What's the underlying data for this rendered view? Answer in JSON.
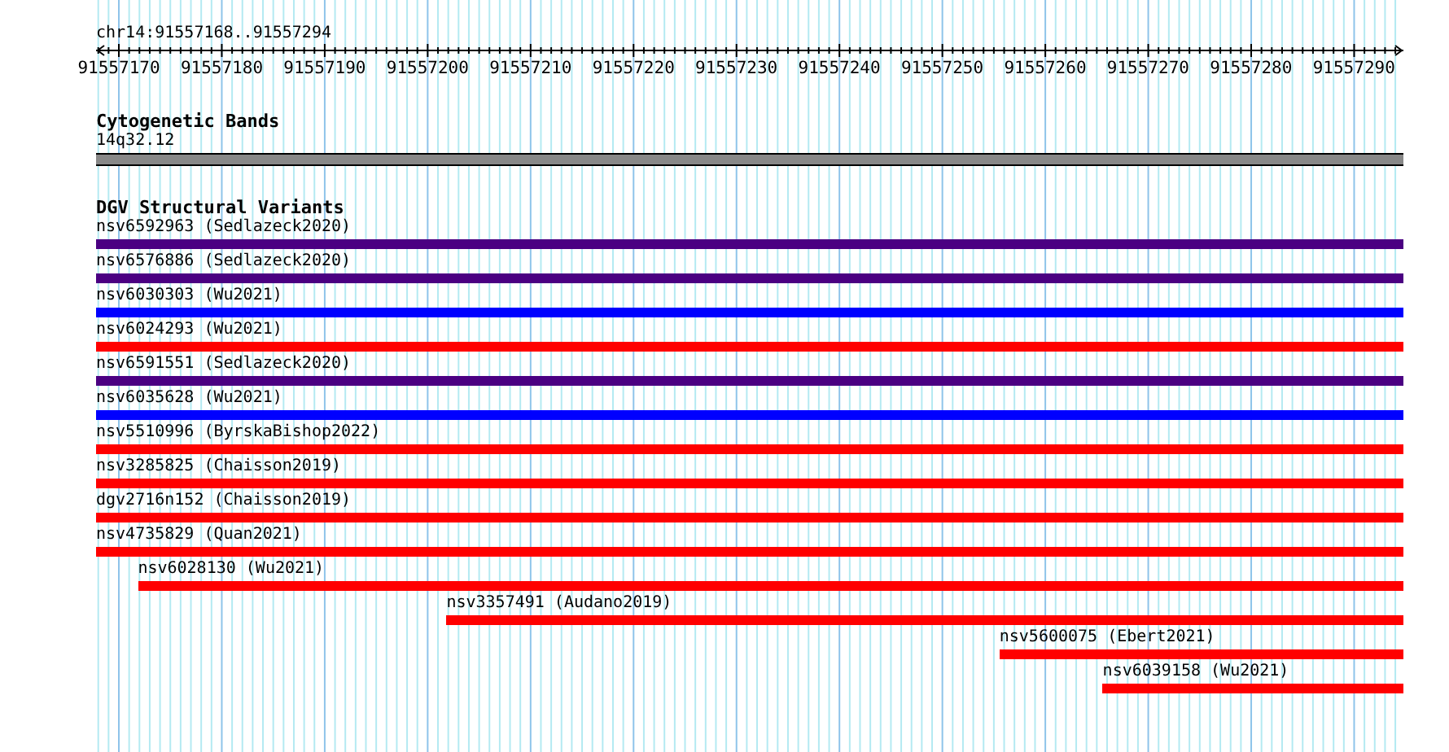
{
  "ruler": {
    "region": "chr14:91557168..91557294",
    "ticks": [
      "91557170",
      "91557180",
      "91557190",
      "91557200",
      "91557210",
      "91557220",
      "91557230",
      "91557240",
      "91557250",
      "91557260",
      "91557270",
      "91557280",
      "91557290"
    ]
  },
  "tracks": [
    {
      "title": "Cytogenetic Bands",
      "kind": "band",
      "items": [
        {
          "label": "14q32.12"
        }
      ]
    },
    {
      "title": "DGV Structural Variants",
      "kind": "variants",
      "items": [
        {
          "label": "nsv6592963 (Sedlazeck2020)",
          "color": "#4b0082",
          "level": 1
        },
        {
          "label": "nsv6576886 (Sedlazeck2020)",
          "color": "#4b0082",
          "level": 1
        },
        {
          "label": "nsv6030303 (Wu2021)",
          "color": "#0000ff",
          "level": 1
        },
        {
          "label": "nsv6024293 (Wu2021)",
          "color": "#ff0000",
          "level": 1
        },
        {
          "label": "nsv6591551 (Sedlazeck2020)",
          "color": "#4b0082",
          "level": 1
        },
        {
          "label": "nsv6035628 (Wu2021)",
          "color": "#0000ff",
          "level": 1
        },
        {
          "label": "nsv5510996 (ByrskaBishop2022)",
          "color": "#ff0000",
          "level": 1
        },
        {
          "label": "nsv3285825 (Chaisson2019)",
          "color": "#ff0000",
          "level": 1
        },
        {
          "label": "dgv2716n152 (Chaisson2019)",
          "color": "#ff0000",
          "level": 1
        },
        {
          "label": "nsv4735829 (Quan2021)",
          "color": "#ff0000",
          "level": 1
        },
        {
          "label": "nsv6028130 (Wu2021)",
          "color": "#ff0000",
          "level": 0.968
        },
        {
          "label": "nsv3357491 (Audano2019)",
          "color": "#ff0000",
          "level": 0.732
        },
        {
          "label": "nsv5600075 (Ebert2021)",
          "color": "#ff0000",
          "level": 0.309
        },
        {
          "label": "nsv6039158 (Wu2021)",
          "color": "#ff0000",
          "level": 0.23
        }
      ]
    }
  ]
}
